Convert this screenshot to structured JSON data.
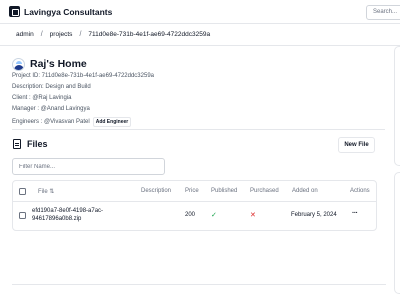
{
  "app": {
    "name": "Lavingya Consultants",
    "search_placeholder": "Search..."
  },
  "breadcrumb": {
    "items": [
      "admin",
      "projects",
      "711d0e8e-731b-4e1f-ae69-4722ddc3259a"
    ]
  },
  "project": {
    "title": "Raj's Home",
    "id_line": "Project ID: 711d0e8e-731b-4e1f-ae69-4722ddc3259a",
    "description_line": "Description: Design and Build",
    "client_line": "Client : @Raj Lavingia",
    "manager_line": "Manager : @Anand Lavingya",
    "engineers_line": "Engineers : @Vivasvan Patel",
    "add_engineer_label": "Add Engineer"
  },
  "files": {
    "title": "Files",
    "new_file_label": "New File",
    "filter_placeholder": "Filter Name...",
    "columns": {
      "file": "File",
      "sort_icon": "⇅",
      "description": "Description",
      "price": "Price",
      "published": "Published",
      "purchased": "Purchased",
      "added_on": "Added on",
      "actions": "Actions"
    },
    "rows": [
      {
        "file_line1": "efd190a7-8e0f-4198-a7ac-",
        "file_line2": "94617896a0b8.zip",
        "description": "",
        "price": "200",
        "published": "✓",
        "purchased": "✕",
        "added_on": "February 5, 2024",
        "actions": "···"
      }
    ]
  },
  "colors": {
    "published": "#16a34a",
    "not_purchased": "#dc2626"
  }
}
